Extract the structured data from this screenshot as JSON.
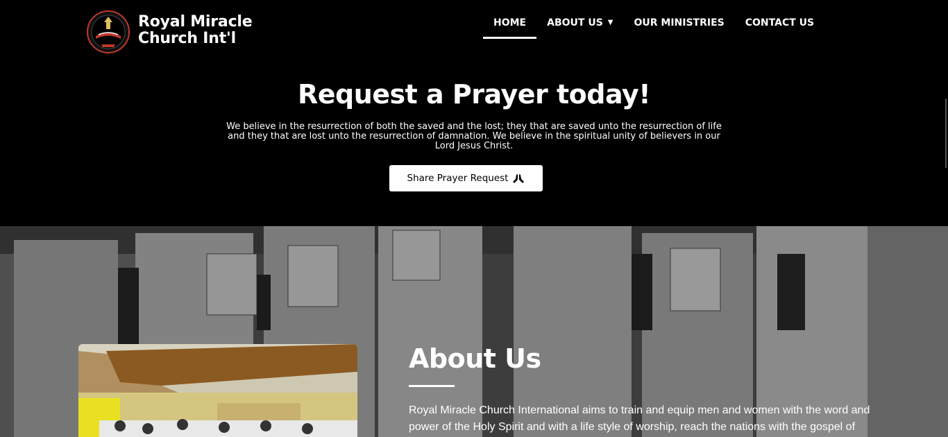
{
  "header": {
    "brand_line1": "Royal Miracle",
    "brand_line2": "Church Int'l",
    "logo_icon": "church-logo-icon"
  },
  "nav": {
    "items": [
      {
        "label": "HOME",
        "active": true
      },
      {
        "label": "ABOUT US",
        "has_dropdown": true
      },
      {
        "label": "OUR MINISTRIES"
      },
      {
        "label": "CONTACT US"
      }
    ]
  },
  "hero": {
    "title": "Request a Prayer today!",
    "text_line1": "We believe in the resurrection of both the saved and the lost; they that are saved unto the resurrection of life",
    "text_line2": "and they that are lost unto the resurrection of damnation. We believe in the spiritual unity of believers in our",
    "text_line3": "Lord Jesus Christ.",
    "cta_label": "Share Prayer Request",
    "cta_icon": "praying-hands-icon"
  },
  "about": {
    "title": "About Us",
    "text_line1": "Royal Miracle Church International aims to train and equip men and women with the word and",
    "text_line2": "power of the Holy Spirit and with a life style of worship, reach the nations with the gospel of"
  },
  "colors": {
    "background": "#000000",
    "text": "#ffffff",
    "button_bg": "#ffffff",
    "button_text": "#000000"
  }
}
